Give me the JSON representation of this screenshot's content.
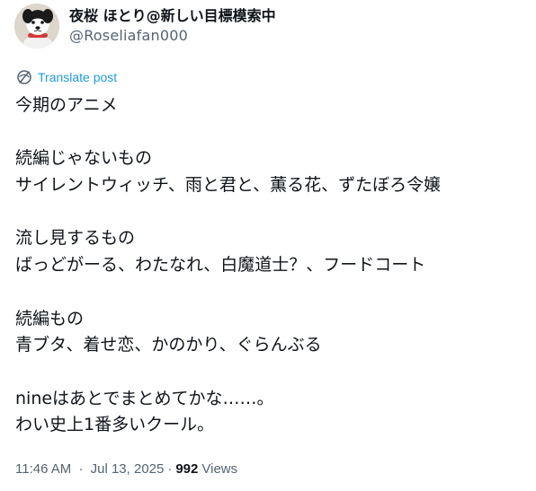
{
  "author": {
    "display_name": "夜桜 ほとり@新しい目標模索中",
    "handle": "@Roseliafan000",
    "avatar_icon": "dog-avatar-icon"
  },
  "translate": {
    "label": "Translate post",
    "icon": "translate-globe-icon"
  },
  "post": {
    "lines": [
      "今期のアニメ",
      "",
      "続編じゃないもの",
      "サイレントウィッチ、雨と君と、薫る花、ずたぼろ令嬢",
      "",
      "流し見するもの",
      "ばっどがーる、わたなれ、白魔道士？、フードコート",
      "",
      "続編もの",
      "青ブタ、着せ恋、かのかり、ぐらんぶる",
      "",
      "nineはあとでまとめてかな……。",
      "わい史上1番多いクール。"
    ]
  },
  "meta": {
    "time": "11:46 AM",
    "separator": "·",
    "date": "Jul 13, 2025",
    "views_count": "992",
    "views_label": "Views"
  },
  "colors": {
    "text": "#0f1419",
    "secondary": "#536471",
    "link": "#1d9bf0"
  }
}
